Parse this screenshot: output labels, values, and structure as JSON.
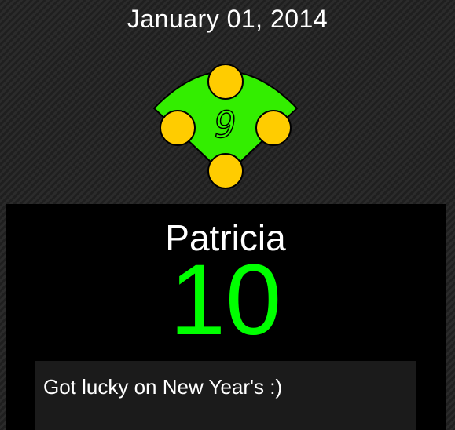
{
  "header": {
    "date": "January 01, 2014"
  },
  "diamond": {
    "inning": "9",
    "colors": {
      "field": "#33ee00",
      "base": "#ffcc00",
      "digit": "#33ff00",
      "outline": "#000000"
    }
  },
  "card": {
    "name": "Patricia",
    "score": "10",
    "note": "Got lucky on New Year's :)",
    "colors": {
      "score": "#00ff00",
      "background": "#000000",
      "note_background": "#1b1b1b"
    }
  }
}
